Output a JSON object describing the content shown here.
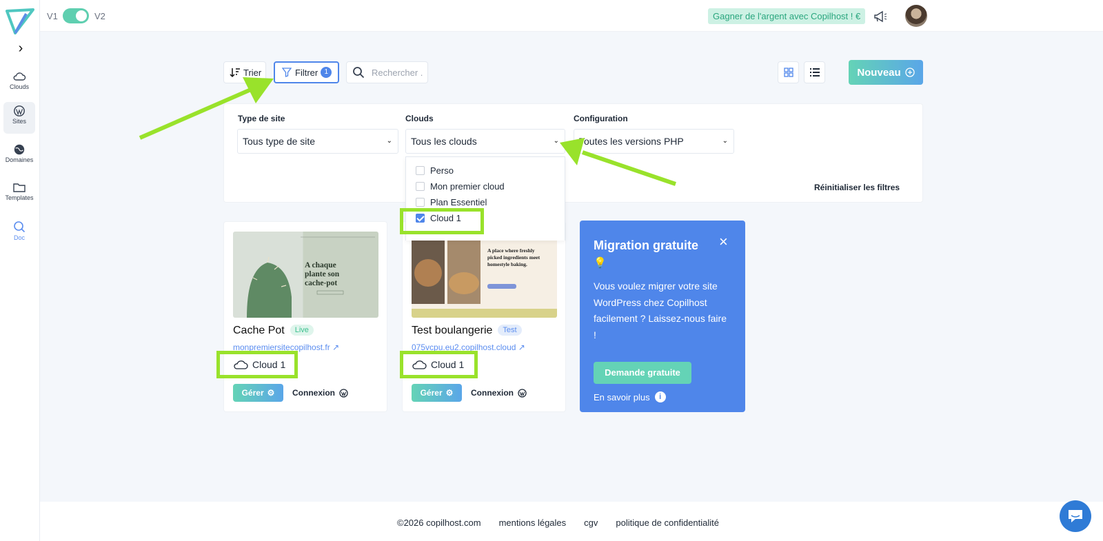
{
  "topbar": {
    "v1_label": "V1",
    "v2_label": "V2",
    "earn_label": "Gagner de l'argent avec Copilhost ! €"
  },
  "sidebar": {
    "items": [
      {
        "label": "Clouds",
        "icon": "cloud-icon"
      },
      {
        "label": "Sites",
        "icon": "wordpress-icon"
      },
      {
        "label": "Domaines",
        "icon": "globe-icon"
      },
      {
        "label": "Templates",
        "icon": "folder-icon"
      },
      {
        "label": "Doc",
        "icon": "search-icon"
      }
    ]
  },
  "toolbar": {
    "sort_label": "Trier",
    "filter_label": "Filtrer",
    "filter_count": "1",
    "search_placeholder": "Rechercher .",
    "new_label": "Nouveau"
  },
  "filters": {
    "site_type": {
      "label": "Type de site",
      "value": "Tous type de site"
    },
    "clouds": {
      "label": "Clouds",
      "value": "Tous les clouds",
      "options": [
        {
          "label": "Perso",
          "checked": false
        },
        {
          "label": "Mon premier cloud",
          "checked": false
        },
        {
          "label": "Plan Essentiel",
          "checked": false
        },
        {
          "label": "Cloud 1",
          "checked": true
        }
      ]
    },
    "config": {
      "label": "Configuration",
      "value": "Toutes les versions PHP"
    },
    "reset_label": "Réinitialiser les filtres"
  },
  "cards": [
    {
      "title": "Cache Pot",
      "status": "Live",
      "url": "monpremiersitecopilhost.fr",
      "cloud": "Cloud 1",
      "manage_label": "Gérer",
      "login_label": "Connexion",
      "thumb_text": "A chaque plante son cache-pot"
    },
    {
      "title": "Test boulangerie",
      "status": "Test",
      "url": "075vcpu.eu2.copilhost.cloud",
      "cloud": "Cloud 1",
      "manage_label": "Gérer",
      "login_label": "Connexion",
      "thumb_text": "A place where freshly picked ingredients meet homestyle baking."
    }
  ],
  "migration": {
    "title": "Migration gratuite",
    "body": "Vous voulez migrer votre site WordPress chez Copilhost facilement ? Laissez-nous faire !",
    "cta": "Demande gratuite",
    "more": "En savoir plus"
  },
  "footer": {
    "links": [
      "©2026 copilhost.com",
      "mentions légales",
      "cgv",
      "politique de confidentialité"
    ]
  },
  "colors": {
    "accent": "#4f86ea",
    "green": "#64d3b6",
    "highlight": "#99e22b"
  }
}
